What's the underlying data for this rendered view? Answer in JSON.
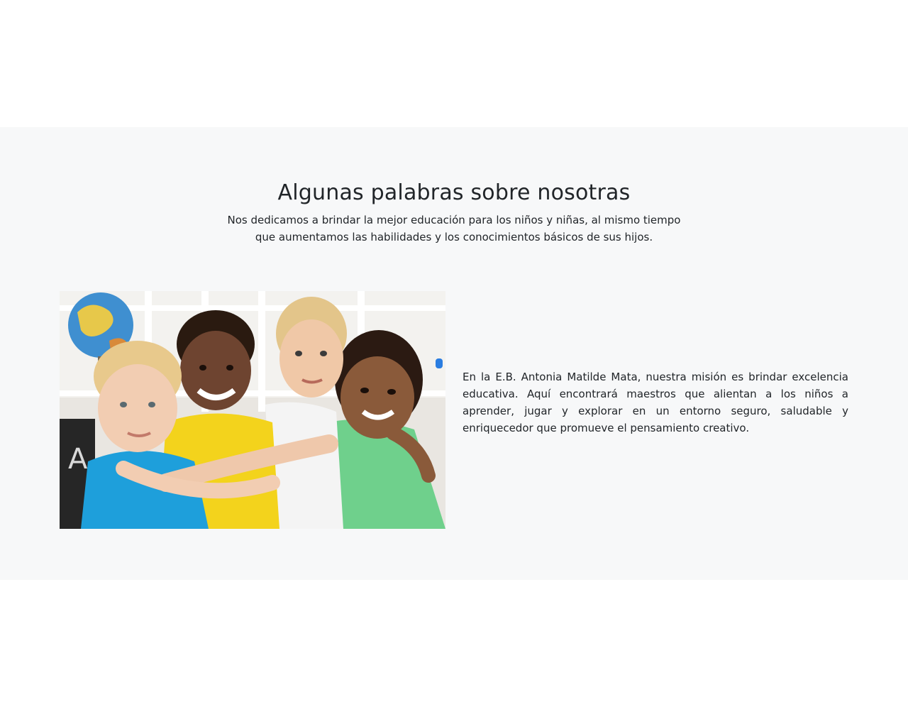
{
  "about": {
    "title": "Algunas palabras sobre nosotras",
    "subtitle": "Nos dedicamos a brindar la mejor educación para los niños y niñas, al mismo tiempo que aumentamos las habilidades y los conocimientos básicos de sus hijos.",
    "description": "En la E.B. Antonia Matilde Mata, nuestra misión es brindar excelencia educativa. Aquí encontrará maestros que alientan a los niños a aprender, jugar y explorar en un entorno seguro, saludable y enriquecedor que promueve el pensamiento creativo.",
    "photo": {
      "icon": "children-group-photo"
    }
  },
  "colors": {
    "section_background": "#f7f8f9",
    "page_background": "#ffffff",
    "text": "#212529"
  }
}
